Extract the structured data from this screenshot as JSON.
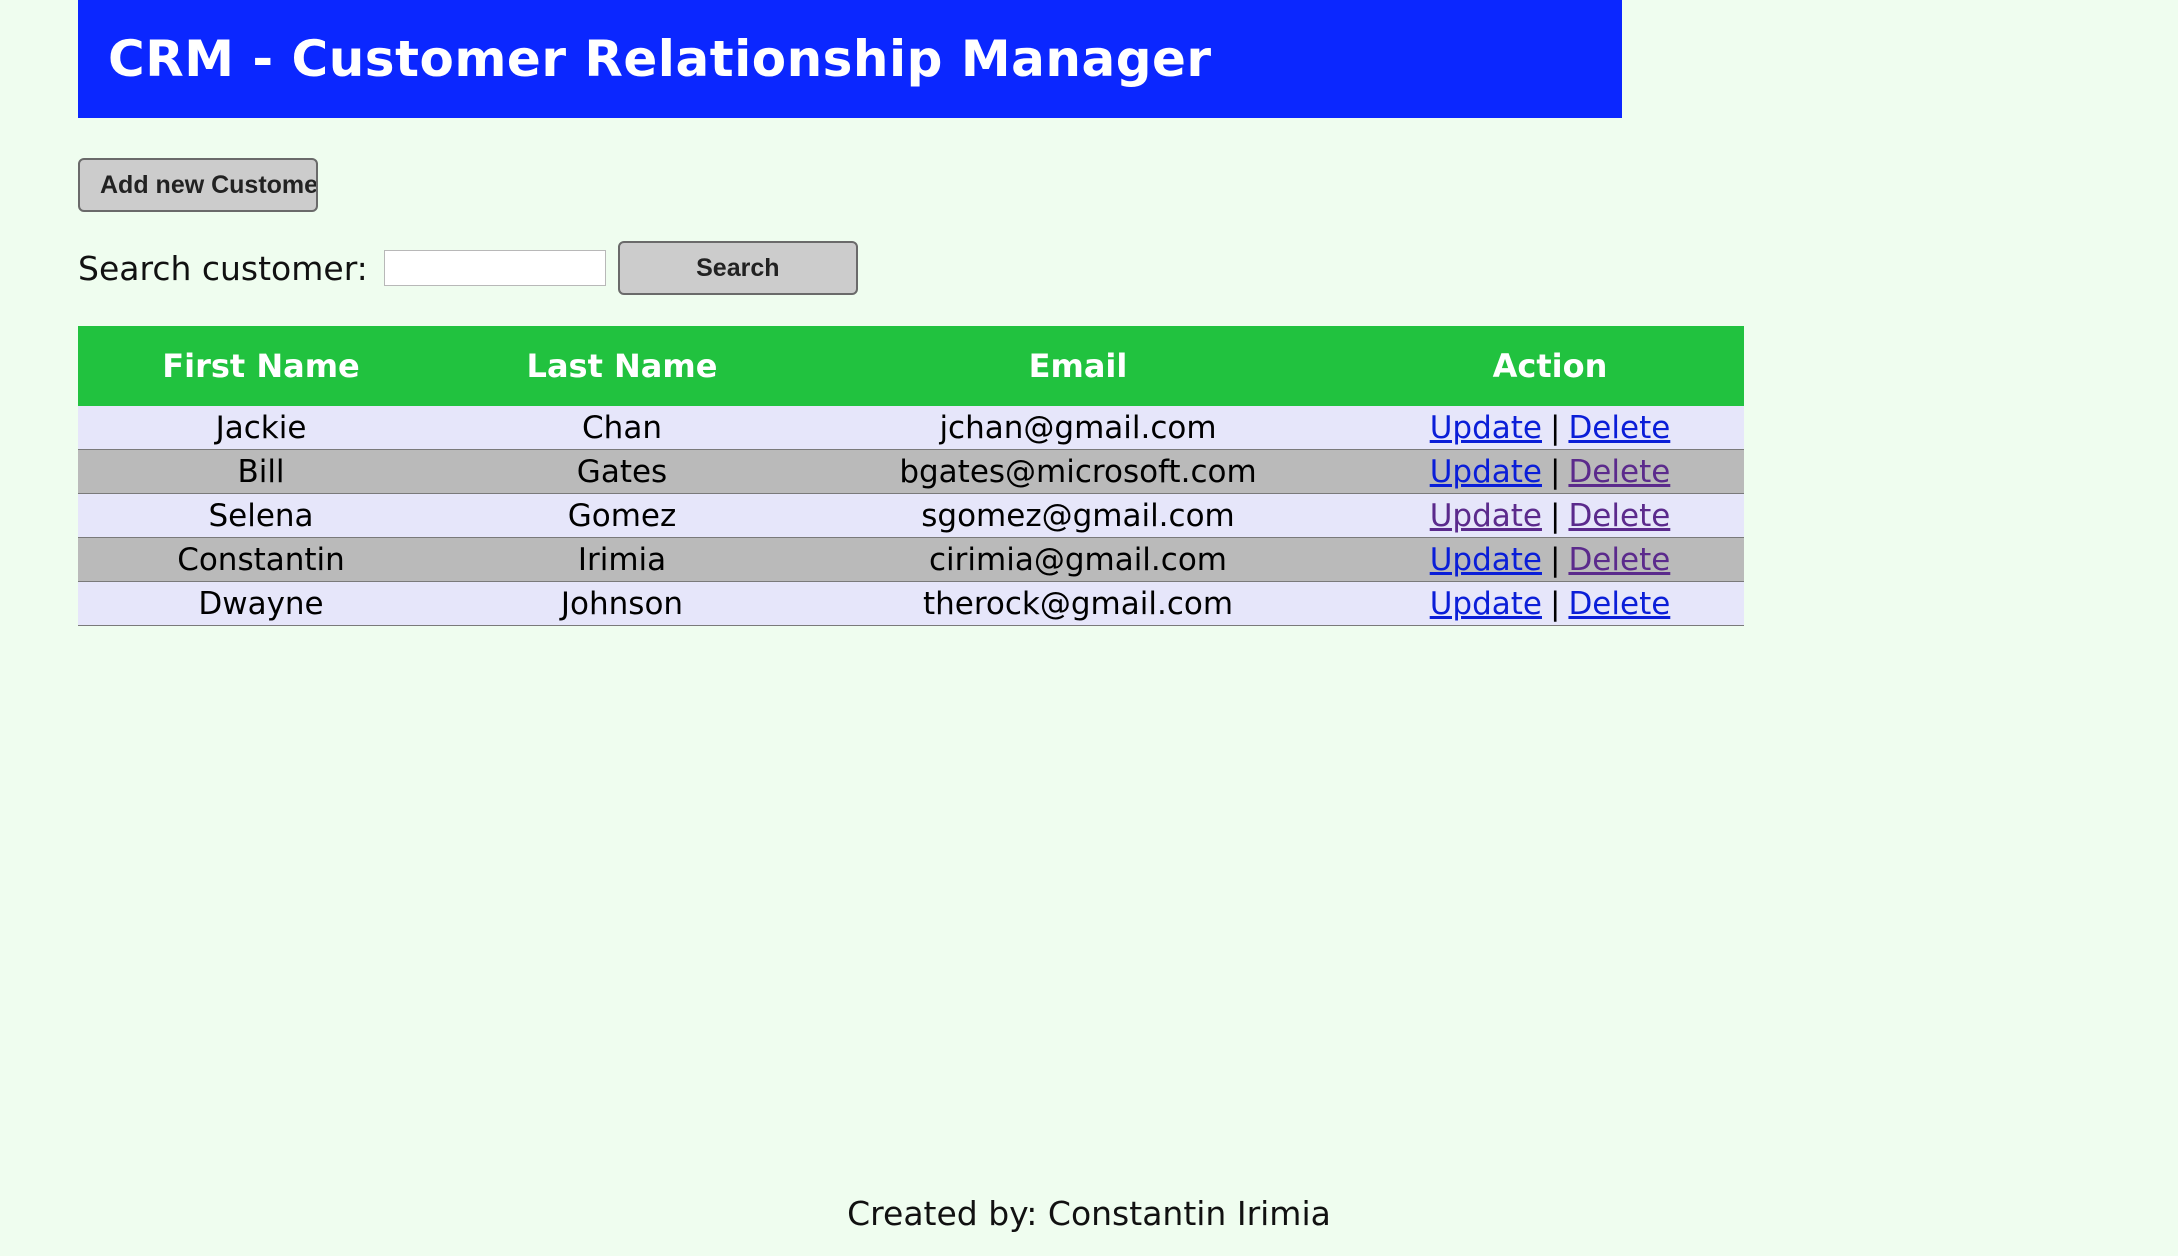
{
  "header": {
    "title": "CRM - Customer Relationship Manager"
  },
  "toolbar": {
    "add_button_label": "Add new Customer"
  },
  "search": {
    "label": "Search customer:",
    "value": "",
    "button_label": "Search"
  },
  "table": {
    "columns": [
      "First Name",
      "Last Name",
      "Email",
      "Action"
    ],
    "rows": [
      {
        "first": "Jackie",
        "last": "Chan",
        "email": "jchan@gmail.com",
        "update": "Update",
        "delete": "Delete",
        "separator": "|"
      },
      {
        "first": "Bill",
        "last": "Gates",
        "email": "bgates@microsoft.com",
        "update": "Update",
        "delete": "Delete",
        "separator": "|"
      },
      {
        "first": "Selena",
        "last": "Gomez",
        "email": "sgomez@gmail.com",
        "update": "Update",
        "delete": "Delete",
        "separator": "|"
      },
      {
        "first": "Constantin",
        "last": "Irimia",
        "email": "cirimia@gmail.com",
        "update": "Update",
        "delete": "Delete",
        "separator": "|"
      },
      {
        "first": "Dwayne",
        "last": "Johnson",
        "email": "therock@gmail.com",
        "update": "Update",
        "delete": "Delete",
        "separator": "|"
      }
    ]
  },
  "footer": {
    "text": "Created by: Constantin Irimia"
  },
  "colors": {
    "header_bg": "#0b27ff",
    "table_header_bg": "#21c23f",
    "row_odd_bg": "#e6e6fa",
    "row_even_bg": "#bababa",
    "page_bg": "#effdef",
    "link_unvisited": "#0a1ed8",
    "link_visited": "#5b2a8c"
  }
}
